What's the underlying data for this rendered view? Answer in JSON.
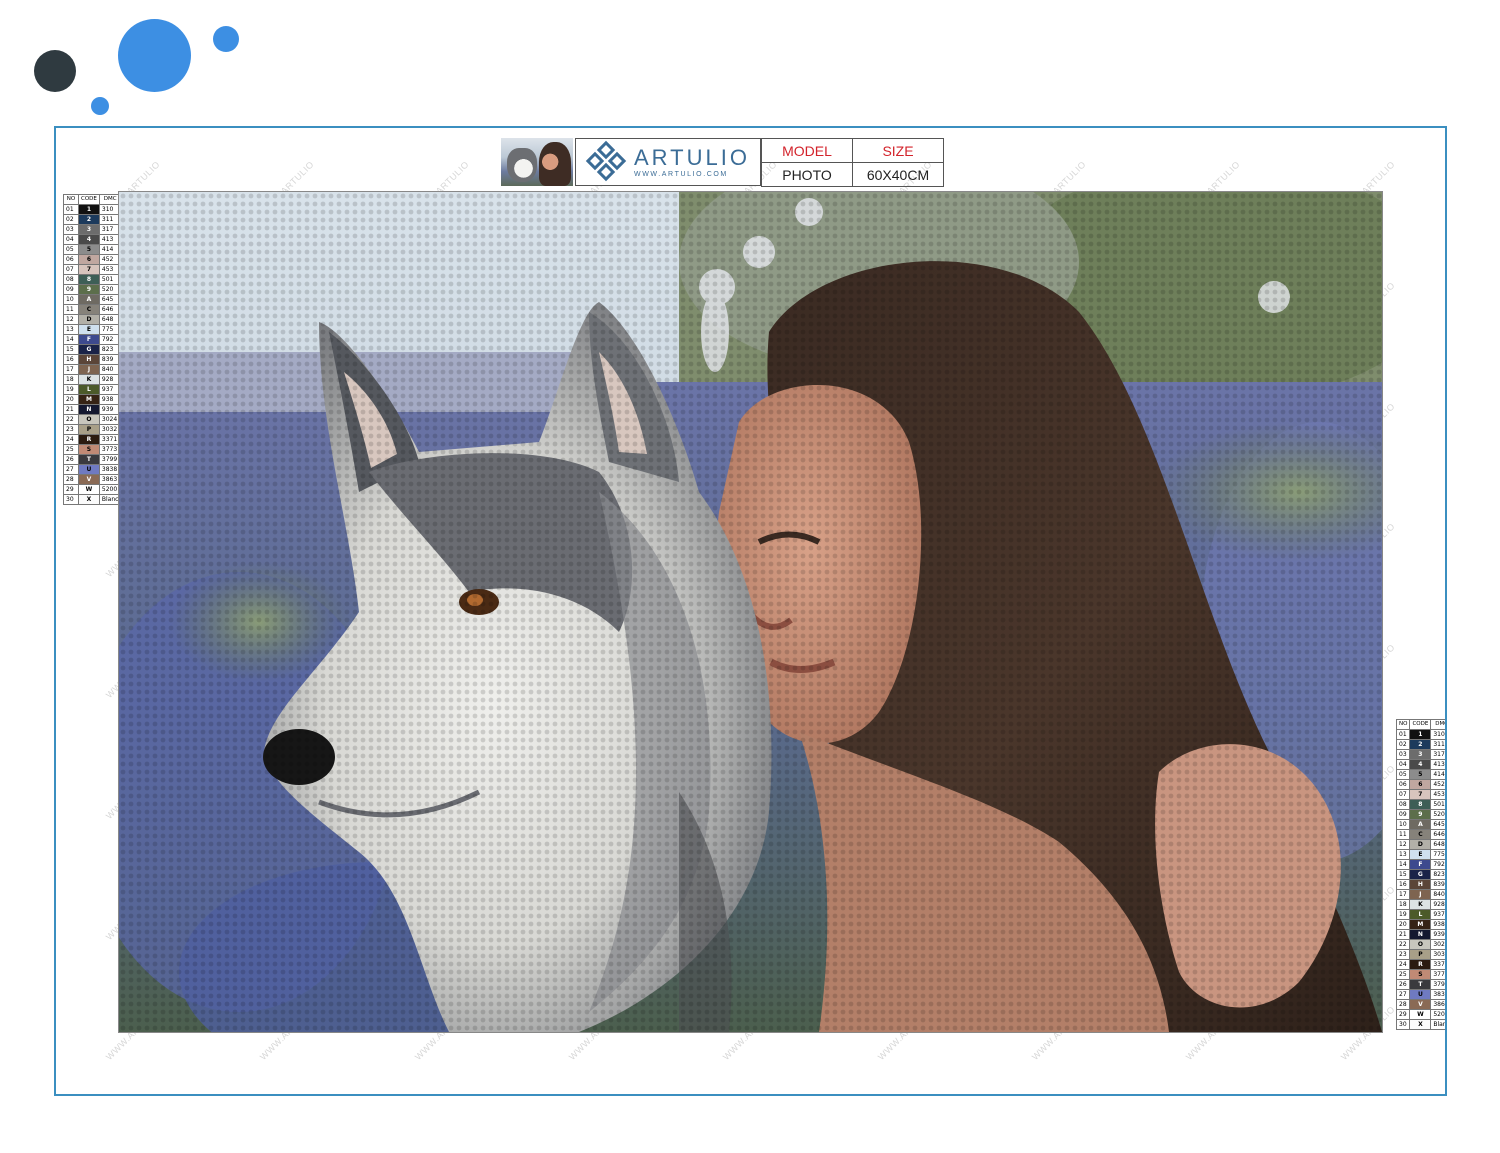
{
  "decor": {
    "dots": [
      {
        "color": "#2f3a40"
      },
      {
        "color": "#3d8fe3"
      },
      {
        "color": "#3d8fe3"
      },
      {
        "color": "#3d8fe3"
      }
    ]
  },
  "header": {
    "brand": "ARTULIO",
    "brand_url": "WWW.ARTULIO.COM",
    "model_label": "MODEL",
    "model_value": "PHOTO",
    "size_label": "SIZE",
    "size_value": "60X40CM"
  },
  "watermark": "WWW.ARTULIO",
  "legend": {
    "headers": [
      "NO",
      "CODE",
      "DMC"
    ],
    "rows": [
      {
        "no": "01",
        "code": "1",
        "dmc": "310",
        "color": "#111111"
      },
      {
        "no": "02",
        "code": "2",
        "dmc": "311",
        "color": "#1c3a5c"
      },
      {
        "no": "03",
        "code": "3",
        "dmc": "317",
        "color": "#6c6c6c"
      },
      {
        "no": "04",
        "code": "4",
        "dmc": "413",
        "color": "#4a4a4a"
      },
      {
        "no": "05",
        "code": "5",
        "dmc": "414",
        "color": "#8c8c8c"
      },
      {
        "no": "06",
        "code": "6",
        "dmc": "452",
        "color": "#c0a7a0"
      },
      {
        "no": "07",
        "code": "7",
        "dmc": "453",
        "color": "#d7c4bd"
      },
      {
        "no": "08",
        "code": "8",
        "dmc": "501",
        "color": "#3d5e56"
      },
      {
        "no": "09",
        "code": "9",
        "dmc": "520",
        "color": "#5c6e4b"
      },
      {
        "no": "10",
        "code": "A",
        "dmc": "645",
        "color": "#6e6a62"
      },
      {
        "no": "11",
        "code": "C",
        "dmc": "646",
        "color": "#86827a"
      },
      {
        "no": "12",
        "code": "D",
        "dmc": "648",
        "color": "#b2b0a8"
      },
      {
        "no": "13",
        "code": "E",
        "dmc": "775",
        "color": "#cfe0ee"
      },
      {
        "no": "14",
        "code": "F",
        "dmc": "792",
        "color": "#3d4a8e"
      },
      {
        "no": "15",
        "code": "G",
        "dmc": "823",
        "color": "#1a2348"
      },
      {
        "no": "16",
        "code": "H",
        "dmc": "839",
        "color": "#5b4538"
      },
      {
        "no": "17",
        "code": "J",
        "dmc": "840",
        "color": "#7e6450"
      },
      {
        "no": "18",
        "code": "K",
        "dmc": "928",
        "color": "#dde3e4"
      },
      {
        "no": "19",
        "code": "L",
        "dmc": "937",
        "color": "#4c5a2a"
      },
      {
        "no": "20",
        "code": "M",
        "dmc": "938",
        "color": "#362315"
      },
      {
        "no": "21",
        "code": "N",
        "dmc": "939",
        "color": "#141830"
      },
      {
        "no": "22",
        "code": "O",
        "dmc": "3024",
        "color": "#c8c6bd"
      },
      {
        "no": "23",
        "code": "P",
        "dmc": "3032",
        "color": "#a89f88"
      },
      {
        "no": "24",
        "code": "R",
        "dmc": "3371",
        "color": "#2b1b10"
      },
      {
        "no": "25",
        "code": "S",
        "dmc": "3773",
        "color": "#c08a75"
      },
      {
        "no": "26",
        "code": "T",
        "dmc": "3799",
        "color": "#3a3a3e"
      },
      {
        "no": "27",
        "code": "U",
        "dmc": "3838",
        "color": "#6f7ac1"
      },
      {
        "no": "28",
        "code": "V",
        "dmc": "3863",
        "color": "#8a6a55"
      },
      {
        "no": "29",
        "code": "W",
        "dmc": "5200",
        "color": "#ffffff"
      },
      {
        "no": "30",
        "code": "X",
        "dmc": "Blanc",
        "color": "#fbfbfb"
      }
    ]
  }
}
